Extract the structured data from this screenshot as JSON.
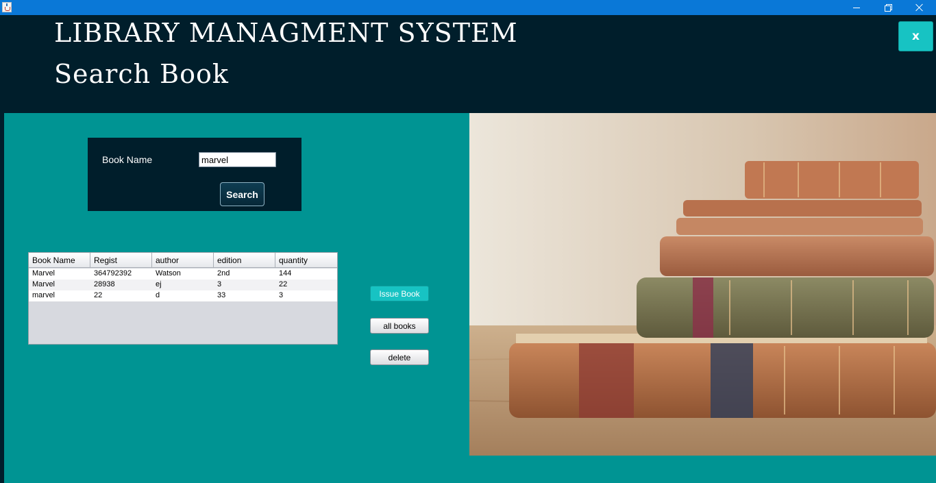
{
  "window": {
    "controls": {
      "minimize_icon": "minimize-icon",
      "restore_icon": "restore-icon",
      "close_icon": "close-icon"
    }
  },
  "header": {
    "app_title": "LIBRARY MANAGMENT SYSTEM",
    "page_title": "Search Book",
    "close_label": "x"
  },
  "search": {
    "label": "Book Name",
    "value": "marvel",
    "button_label": "Search"
  },
  "table": {
    "columns": [
      "Book Name",
      "Regist",
      "author",
      "edition",
      "quantity"
    ],
    "rows": [
      [
        "Marvel",
        "364792392",
        "Watson",
        "2nd",
        "144"
      ],
      [
        "Marvel",
        "28938",
        "ej",
        "3",
        "22"
      ],
      [
        "marvel",
        "22",
        "d",
        "33",
        "3"
      ]
    ]
  },
  "actions": {
    "issue_label": "Issue Book",
    "all_books_label": "all books",
    "delete_label": "delete"
  },
  "colors": {
    "header_bg": "#001e2b",
    "panel_bg": "#009493",
    "accent": "#17c3c3",
    "titlebar": "#0a78d7"
  }
}
